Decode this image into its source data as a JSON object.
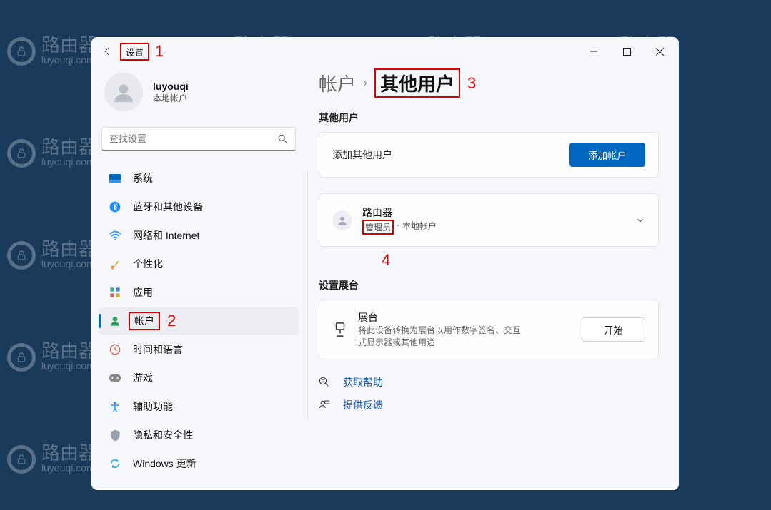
{
  "watermark": {
    "title": "路由器",
    "sub": "luyouqi.com"
  },
  "window": {
    "title": "设置"
  },
  "annotations": {
    "a1": "1",
    "a2": "2",
    "a3": "3",
    "a4": "4"
  },
  "profile": {
    "name": "luyouqi",
    "sub": "本地帐户"
  },
  "search": {
    "placeholder": "查找设置"
  },
  "sidebar": {
    "items": [
      {
        "label": "系统"
      },
      {
        "label": "蓝牙和其他设备"
      },
      {
        "label": "网络和 Internet"
      },
      {
        "label": "个性化"
      },
      {
        "label": "应用"
      },
      {
        "label": "帐户"
      },
      {
        "label": "时间和语言"
      },
      {
        "label": "游戏"
      },
      {
        "label": "辅助功能"
      },
      {
        "label": "隐私和安全性"
      },
      {
        "label": "Windows 更新"
      }
    ]
  },
  "breadcrumb": {
    "parent": "帐户",
    "current": "其他用户"
  },
  "content": {
    "other_users_heading": "其他用户",
    "add_other_user_label": "添加其他用户",
    "add_account_btn": "添加帐户",
    "user": {
      "name": "路由器",
      "role": "管理员",
      "type": "本地帐户"
    },
    "kiosk_heading": "设置展台",
    "kiosk_title": "展台",
    "kiosk_desc": "将此设备转换为展台以用作数字签名、交互式显示器或其他用途",
    "kiosk_btn": "开始",
    "help_link": "获取帮助",
    "feedback_link": "提供反馈"
  }
}
